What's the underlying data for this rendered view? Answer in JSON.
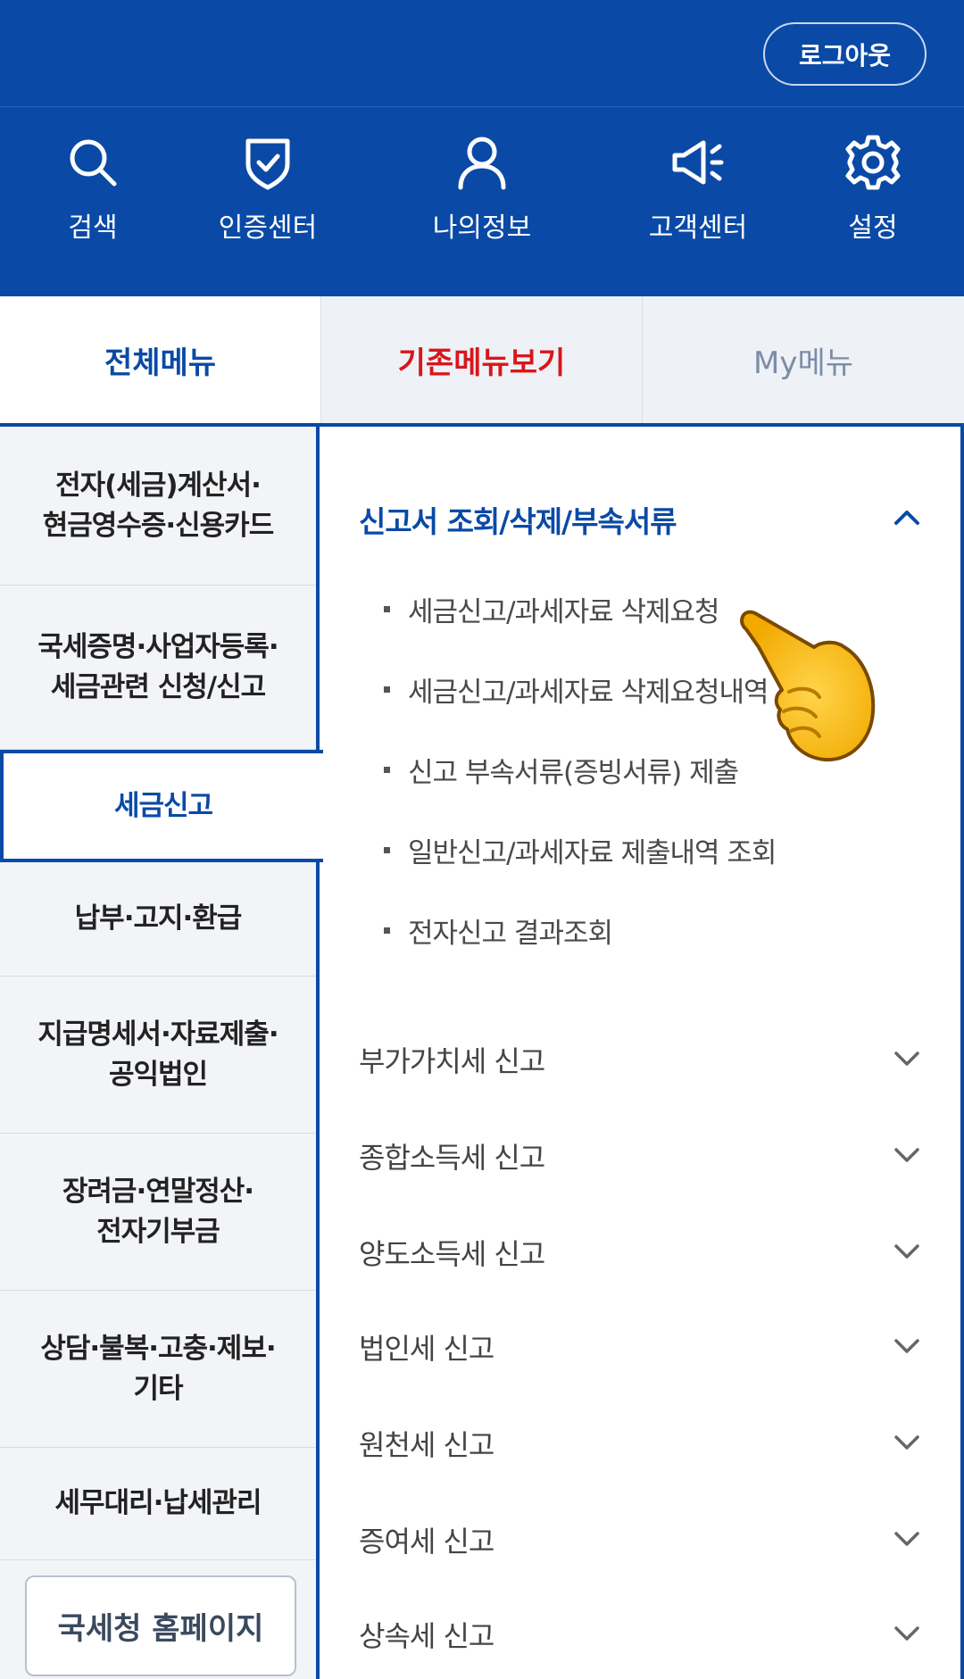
{
  "header": {
    "logout_label": "로그아웃",
    "icons": [
      {
        "icon": "search-icon",
        "label": "검색"
      },
      {
        "icon": "shield-check-icon",
        "label": "인증센터"
      },
      {
        "icon": "person-icon",
        "label": "나의정보"
      },
      {
        "icon": "megaphone-icon",
        "label": "고객센터"
      },
      {
        "icon": "gear-icon",
        "label": "설정"
      }
    ]
  },
  "tabs": {
    "all": "전체메뉴",
    "classic": "기존메뉴보기",
    "my": "My메뉴"
  },
  "sidebar": {
    "items": [
      {
        "label_1": "전자(세금)계산서·",
        "label_2": "현금영수증·신용카드"
      },
      {
        "label_1": "국세증명·사업자등록·",
        "label_2": "세금관련 신청/신고"
      },
      {
        "label_1": "세금신고",
        "label_2": ""
      },
      {
        "label_1": "납부·고지·환급",
        "label_2": ""
      },
      {
        "label_1": "지급명세서·자료제출·",
        "label_2": "공익법인"
      },
      {
        "label_1": "장려금·연말정산·",
        "label_2": "전자기부금"
      },
      {
        "label_1": "상담·불복·고충·제보·",
        "label_2": "기타"
      },
      {
        "label_1": "세무대리·납세관리",
        "label_2": ""
      }
    ],
    "active_index": 2,
    "home_button": "국세청 홈페이지"
  },
  "panel": {
    "section_title": "신고서 조회/삭제/부속서류",
    "sub_items": [
      "세금신고/과세자료 삭제요청",
      "세금신고/과세자료 삭제요청내역",
      "신고 부속서류(증빙서류) 제출",
      "일반신고/과세자료 제출내역 조회",
      "전자신고 결과조회"
    ],
    "categories": [
      "부가가치세 신고",
      "종합소득세 신고",
      "양도소득세 신고",
      "법인세 신고",
      "원천세 신고",
      "증여세 신고",
      "상속세 신고"
    ]
  },
  "colors": {
    "brand_blue": "#0a4aa6",
    "accent_red": "#d8171c",
    "muted_blue": "#7b8da6"
  }
}
